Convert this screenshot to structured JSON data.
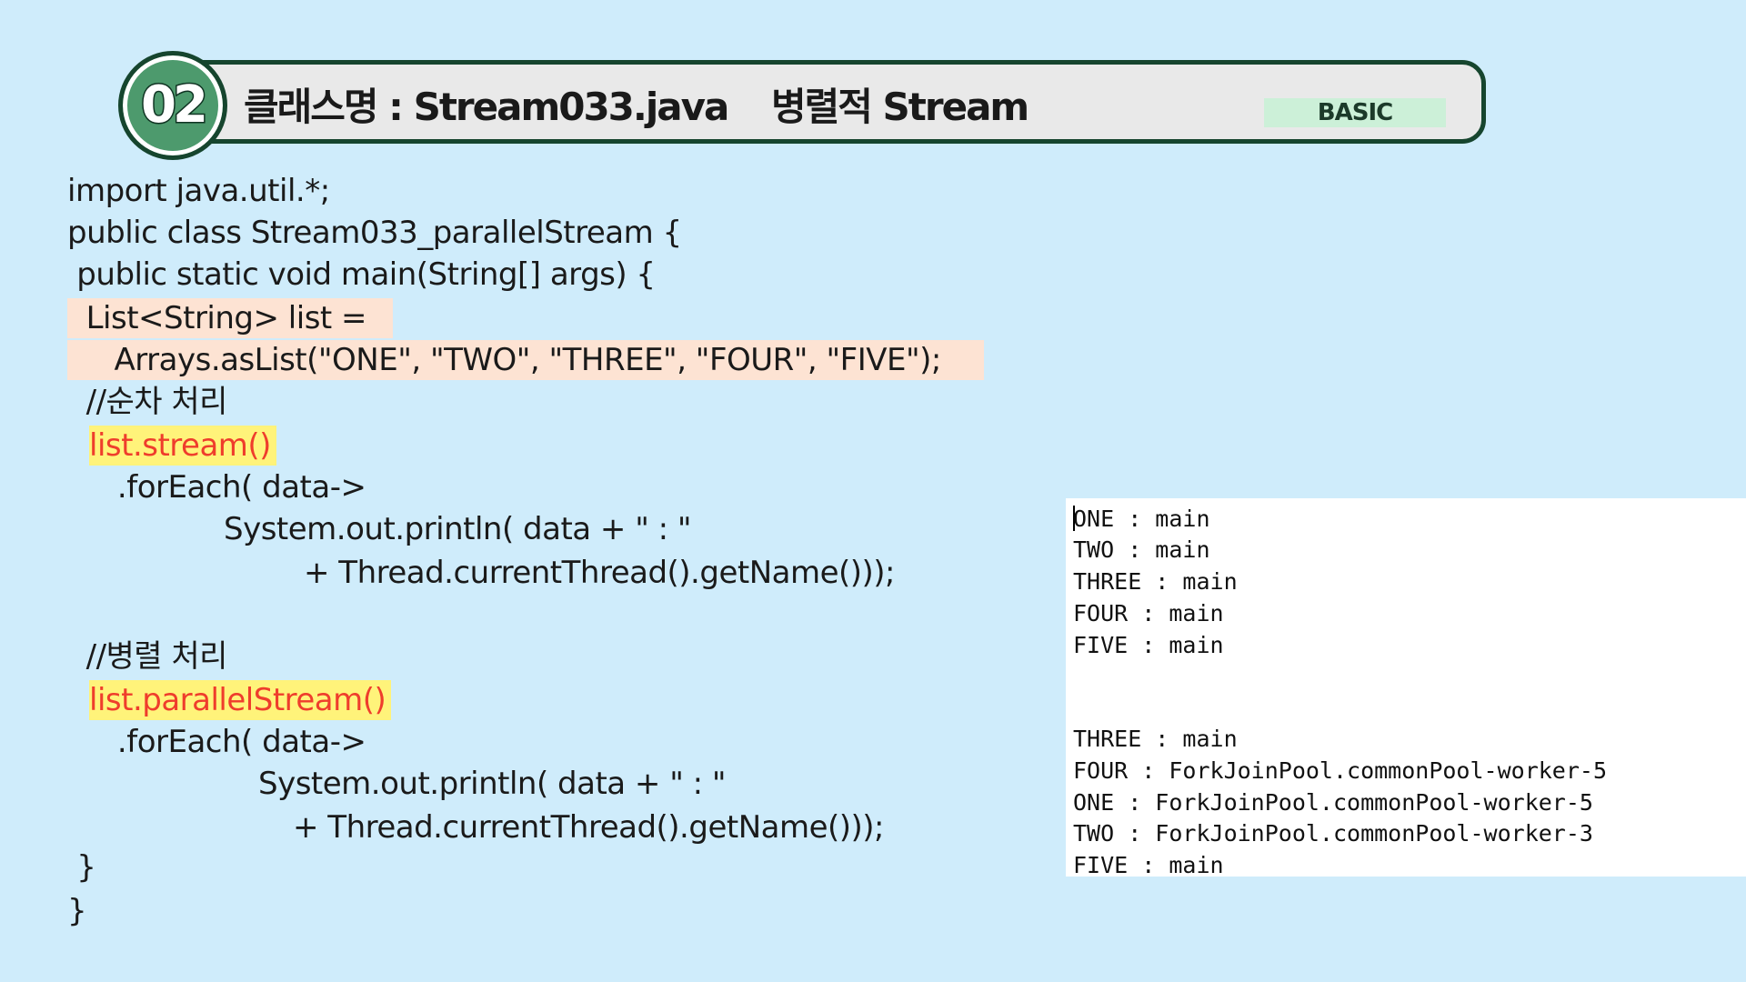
{
  "header": {
    "number": "02",
    "title": "클래스명 : Stream033.java",
    "subtitle": "병렬적 Stream",
    "level": "BASIC"
  },
  "code": {
    "lines": [
      "import java.util.*;",
      "public class Stream033_parallelStream {",
      " public static void main(String[] args) {",
      "  List<String> list =",
      "     Arrays.asList(\"ONE\", \"TWO\", \"THREE\", \"FOUR\", \"FIVE\");",
      "  //순차 처리",
      "list.stream()",
      "   .forEach( data->",
      "System.out.println( data + \" : \"",
      "+ Thread.currentThread().getName()));",
      "  //병렬 처리",
      "list.parallelStream()",
      "   .forEach( data->",
      "System.out.println( data + \" : \"",
      "+ Thread.currentThread().getName()));",
      " }",
      "}"
    ]
  },
  "console": {
    "lines": [
      "ONE : main",
      "TWO : main",
      "THREE : main",
      "FOUR : main",
      "FIVE : main",
      "THREE : main",
      "FOUR : ForkJoinPool.commonPool-worker-5",
      "ONE : ForkJoinPool.commonPool-worker-5",
      "TWO : ForkJoinPool.commonPool-worker-3",
      "FIVE : main"
    ]
  },
  "colors": {
    "background": "#cfecfb",
    "header_border": "#16452e",
    "badge_fill": "#4d9a6d",
    "tag_fill": "#ccf0d8",
    "highlight_peach": "#fde3d3",
    "highlight_yellow": "#fff37a",
    "highlight_text": "#ef3d2c"
  }
}
